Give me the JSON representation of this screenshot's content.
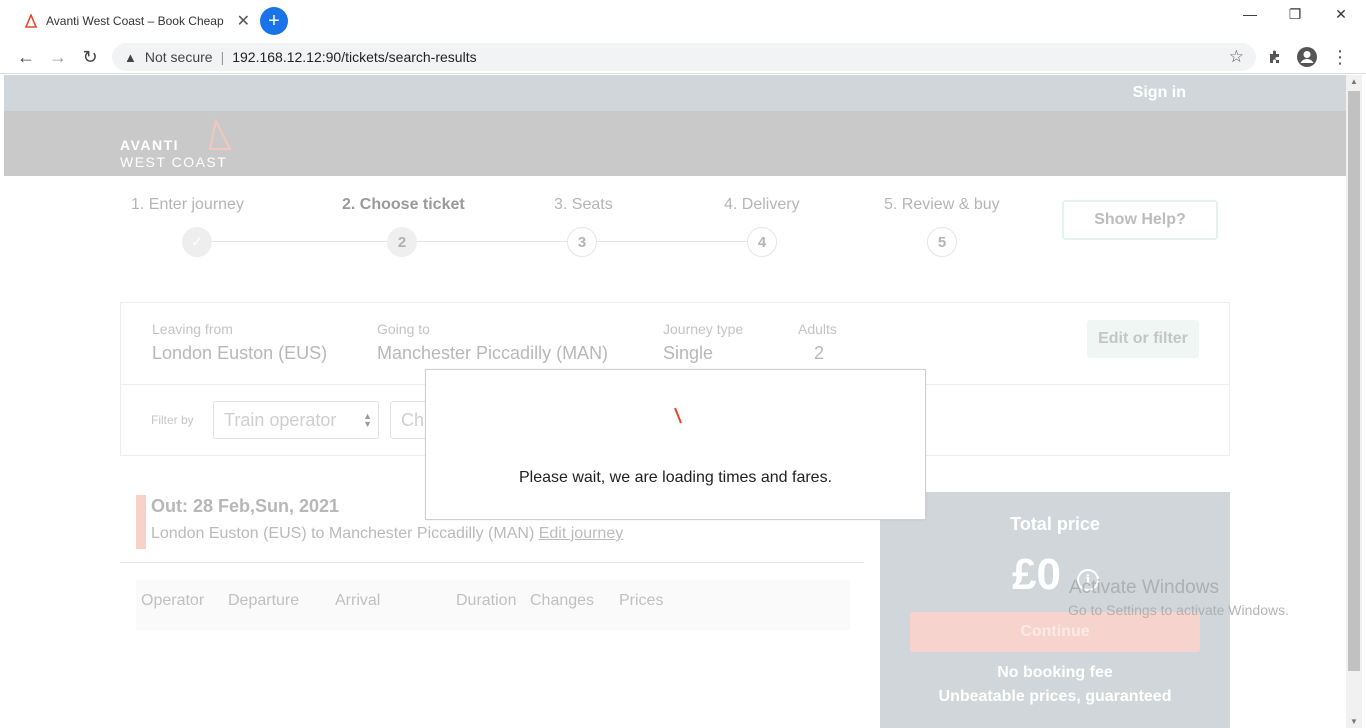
{
  "browser": {
    "tab_title": "Avanti West Coast – Book Cheap",
    "tab_close": "✕",
    "new_tab": "+",
    "window_controls": {
      "minimize": "—",
      "restore": "❐",
      "close": "✕"
    },
    "nav": {
      "back": "←",
      "forward": "→",
      "reload": "↻"
    },
    "security_label": "Not secure",
    "separator": "|",
    "url": "192.168.12.12:90/tickets/search-results",
    "menu": "⋮"
  },
  "header": {
    "sign_in": "Sign in",
    "logo_line1": "AVANTI",
    "logo_line2": "WEST COAST"
  },
  "steps": [
    {
      "label": "1. Enter journey",
      "number": "✓",
      "state": "done"
    },
    {
      "label": "2. Choose ticket",
      "number": "2",
      "state": "active"
    },
    {
      "label": "3. Seats",
      "number": "3",
      "state": "pending"
    },
    {
      "label": "4. Delivery",
      "number": "4",
      "state": "pending"
    },
    {
      "label": "5. Review & buy",
      "number": "5",
      "state": "pending"
    }
  ],
  "help_button": "Show Help?",
  "search": {
    "leaving_label": "Leaving from",
    "leaving_value": "London Euston (EUS)",
    "going_label": "Going to",
    "going_value": "Manchester Piccadilly (MAN)",
    "journey_type_label": "Journey type",
    "journey_type_value": "Single",
    "adults_label": "Adults",
    "adults_value": "2",
    "edit_filter": "Edit or filter",
    "filter_by": "Filter by",
    "operator_select": "Train operator",
    "changes_select": "Ch"
  },
  "outbound": {
    "title": "Out: 28 Feb,Sun, 2021",
    "route": "London Euston (EUS) to Manchester Piccadilly (MAN)",
    "edit_journey": "Edit journey",
    "columns": [
      "Operator",
      "Departure",
      "Arrival",
      "Duration",
      "Changes",
      "Prices"
    ]
  },
  "total": {
    "label": "Total price",
    "amount": "£0",
    "info": "i",
    "continue": "Continue",
    "no_booking_fee": "No booking fee",
    "unbeatable": "Unbeatable prices, guaranteed"
  },
  "watermark": {
    "line1": "Activate Windows",
    "line2": "Go to Settings to activate Windows."
  },
  "modal": {
    "message": "Please wait, we are loading times and fares."
  },
  "colors": {
    "brand_orange": "#e8462a",
    "chrome_blue": "#1a73e8",
    "header_grey": "#c9c9c9",
    "panel_grey": "#d0d6d9"
  }
}
